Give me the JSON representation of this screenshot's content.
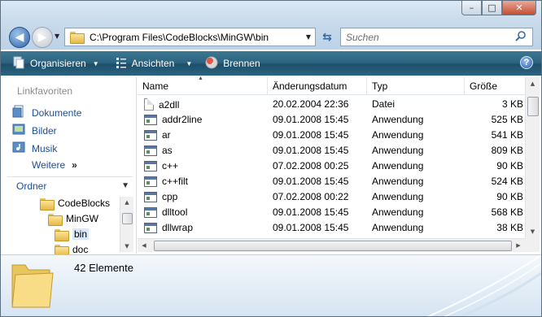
{
  "window": {
    "controls": {
      "minimize": "–",
      "maximize": "□",
      "close": "✕"
    }
  },
  "nav": {
    "address": "C:\\Program Files\\CodeBlocks\\MinGW\\bin",
    "search_placeholder": "Suchen"
  },
  "toolbar": {
    "organize": "Organisieren",
    "views": "Ansichten",
    "burn": "Brennen",
    "help": "?"
  },
  "left_pane": {
    "favorites_header": "Linkfavoriten",
    "favorites": [
      {
        "label": "Dokumente",
        "icon": "documents-icon"
      },
      {
        "label": "Bilder",
        "icon": "pictures-icon"
      },
      {
        "label": "Musik",
        "icon": "music-icon"
      }
    ],
    "more": "Weitere",
    "more_chevron": "»",
    "folders_header": "Ordner",
    "tree": [
      {
        "label": "CodeBlocks",
        "selected": false
      },
      {
        "label": "MinGW",
        "selected": false
      },
      {
        "label": "bin",
        "selected": true
      },
      {
        "label": "doc",
        "selected": false
      }
    ]
  },
  "file_list": {
    "columns": {
      "name": "Name",
      "date": "Änderungsdatum",
      "type": "Typ",
      "size": "Größe"
    },
    "rows": [
      {
        "name": "a2dll",
        "date": "20.02.2004 22:36",
        "type": "Datei",
        "size": "3 KB",
        "icon": "file-icon"
      },
      {
        "name": "addr2line",
        "date": "09.01.2008 15:45",
        "type": "Anwendung",
        "size": "525 KB",
        "icon": "app-icon"
      },
      {
        "name": "ar",
        "date": "09.01.2008 15:45",
        "type": "Anwendung",
        "size": "541 KB",
        "icon": "app-icon"
      },
      {
        "name": "as",
        "date": "09.01.2008 15:45",
        "type": "Anwendung",
        "size": "809 KB",
        "icon": "app-icon"
      },
      {
        "name": "c++",
        "date": "07.02.2008 00:25",
        "type": "Anwendung",
        "size": "90 KB",
        "icon": "app-icon"
      },
      {
        "name": "c++filt",
        "date": "09.01.2008 15:45",
        "type": "Anwendung",
        "size": "524 KB",
        "icon": "app-icon"
      },
      {
        "name": "cpp",
        "date": "07.02.2008 00:22",
        "type": "Anwendung",
        "size": "90 KB",
        "icon": "app-icon"
      },
      {
        "name": "dlltool",
        "date": "09.01.2008 15:45",
        "type": "Anwendung",
        "size": "568 KB",
        "icon": "app-icon"
      },
      {
        "name": "dllwrap",
        "date": "09.01.2008 15:45",
        "type": "Anwendung",
        "size": "38 KB",
        "icon": "app-icon"
      }
    ]
  },
  "details": {
    "count": "42 Elemente"
  },
  "colors": {
    "toolbar": "#2c6582",
    "link": "#1d4f96",
    "selection": "#d9e8fb"
  }
}
